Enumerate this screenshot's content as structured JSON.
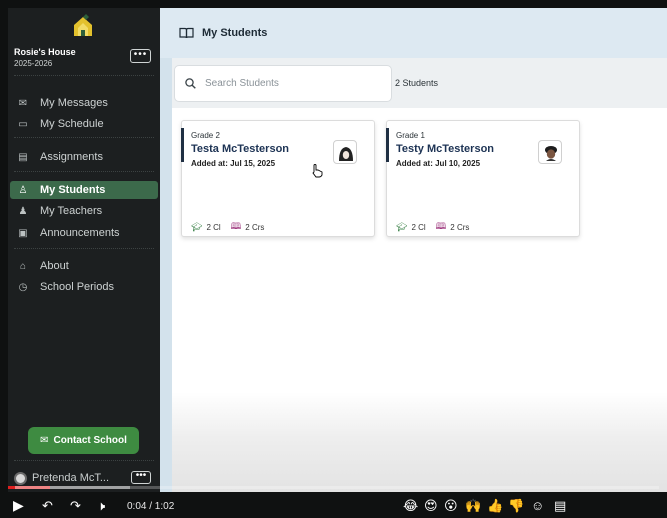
{
  "sidebar": {
    "house_name": "Rosie's House",
    "school_year": "2025-2026",
    "more_label": "•••",
    "items": [
      {
        "label": "My Messages",
        "icon": "mail-icon"
      },
      {
        "label": "My Schedule",
        "icon": "calendar-icon"
      },
      {
        "label": "Assignments",
        "icon": "assignment-icon"
      },
      {
        "label": "My Students",
        "icon": "student-icon",
        "active": true
      },
      {
        "label": "My Teachers",
        "icon": "teacher-icon"
      },
      {
        "label": "Announcements",
        "icon": "announcement-icon"
      },
      {
        "label": "About",
        "icon": "school-building-icon"
      },
      {
        "label": "School Periods",
        "icon": "clock-icon"
      }
    ],
    "contact_button": "Contact School",
    "user_name": "Pretenda McT...",
    "user_more": "•••"
  },
  "header": {
    "title": "My Students"
  },
  "search": {
    "placeholder": "Search Students",
    "count": "2 Students"
  },
  "students": [
    {
      "grade": "Grade 2",
      "name": "Testa McTesterson",
      "added": "Added at: Jul 15, 2025",
      "classes": "2 Cl",
      "courses": "2 Crs"
    },
    {
      "grade": "Grade 1",
      "name": "Testy McTesterson",
      "added": "Added at: Jul 10, 2025",
      "classes": "2 Cl",
      "courses": "2 Crs"
    }
  ],
  "video": {
    "time": "0:04 / 1:02",
    "progress_fraction": 0.064
  },
  "colors": {
    "sidebar_bg": "#1c1f20",
    "active_item": "#3c6a4b",
    "contact_button": "#3e8b41",
    "topbar": "#dde9f2",
    "card_accent": "#1f2f43",
    "name_text": "#1d3354"
  }
}
